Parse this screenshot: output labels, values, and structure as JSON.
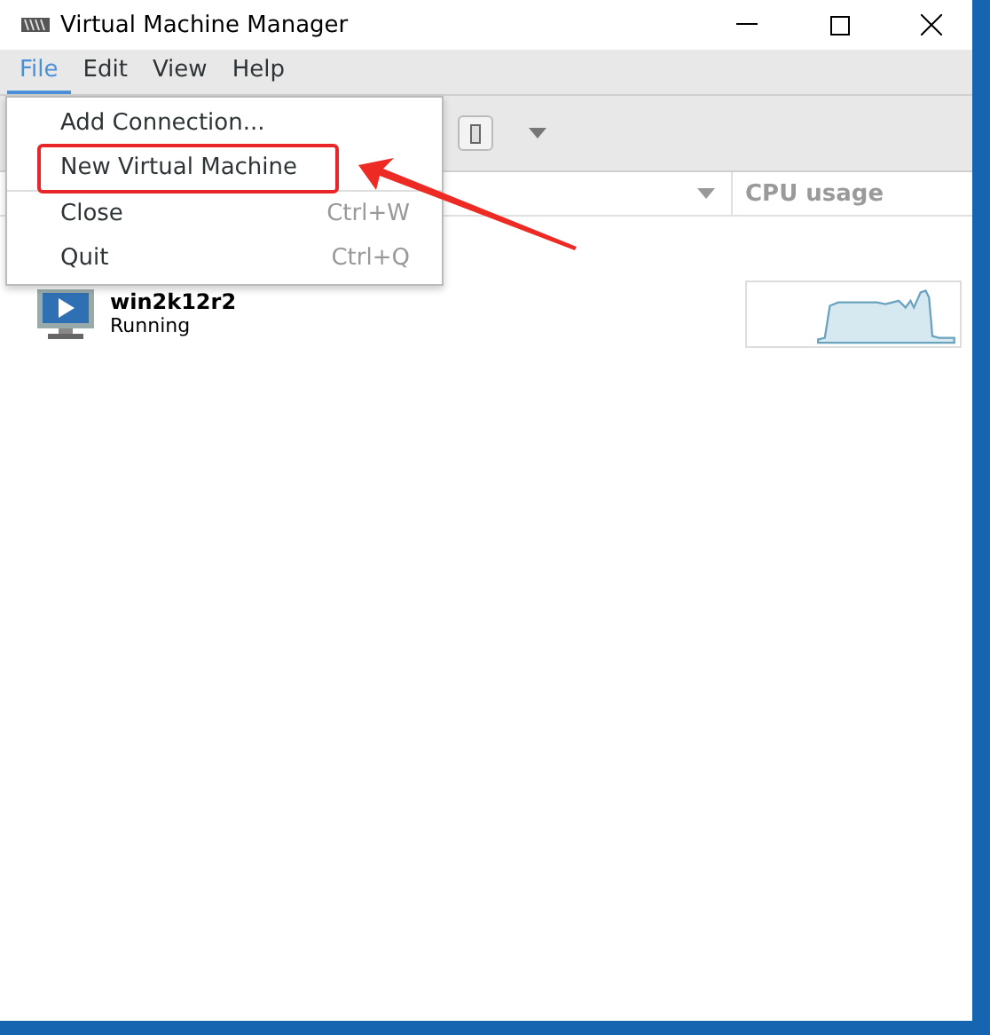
{
  "window": {
    "title": "Virtual Machine Manager"
  },
  "menu_bar": [
    {
      "label": "File",
      "selected": true
    },
    {
      "label": "Edit",
      "selected": false
    },
    {
      "label": "View",
      "selected": false
    },
    {
      "label": "Help",
      "selected": false
    }
  ],
  "file_menu": [
    {
      "label": "Add Connection...",
      "boxed": false
    },
    {
      "label": "New Virtual Machine",
      "boxed": true
    },
    {
      "label": "Close",
      "shortcut": "Ctrl+W",
      "boxed": false
    },
    {
      "label": "Quit",
      "shortcut": "Ctrl+Q",
      "boxed": false
    }
  ],
  "table": {
    "columns": [
      {
        "label": "CPU usage"
      }
    ],
    "rows": [
      {
        "name": "win2k12r2",
        "status": "Running"
      }
    ]
  }
}
